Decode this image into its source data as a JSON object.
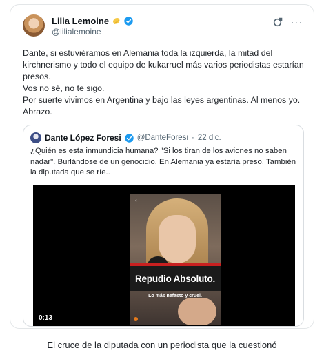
{
  "tweet": {
    "author": {
      "display_name": "Lilia Lemoine",
      "handle": "@lilialemoine",
      "emoji_icon": "emoji-icon",
      "verified_color": "#1d9bf0"
    },
    "actions": {
      "grok_icon": "grok-icon",
      "more_label": "···"
    },
    "text_lines": [
      "Dante, si estuviéramos en Alemania toda la izquierda, la mitad del kirchnerismo y todo el equipo de kukarruel más varios periodistas estarían presos.",
      "Vos no sé, no te sigo.",
      "Por suerte vivimos en Argentina y bajo las leyes argentinas. Al menos yo.",
      "Abrazo."
    ]
  },
  "quote": {
    "display_name": "Dante López Foresi",
    "handle": "@DanteForesi",
    "dot": "·",
    "date": "22 dic.",
    "text": "¿Quién es esta inmundicia humana? \"Si los tiran de los aviones no saben nadar\". Burlándose de un genocidio. En Alemania ya estaría preso. También la diputada que se ríe..",
    "video": {
      "caption": "Repudio Absoluto.",
      "subcaption": "Lo más nefasto y cruel.",
      "timecode": "0:13"
    }
  },
  "page_caption": "El cruce de la diputada con un periodista que la cuestionó"
}
